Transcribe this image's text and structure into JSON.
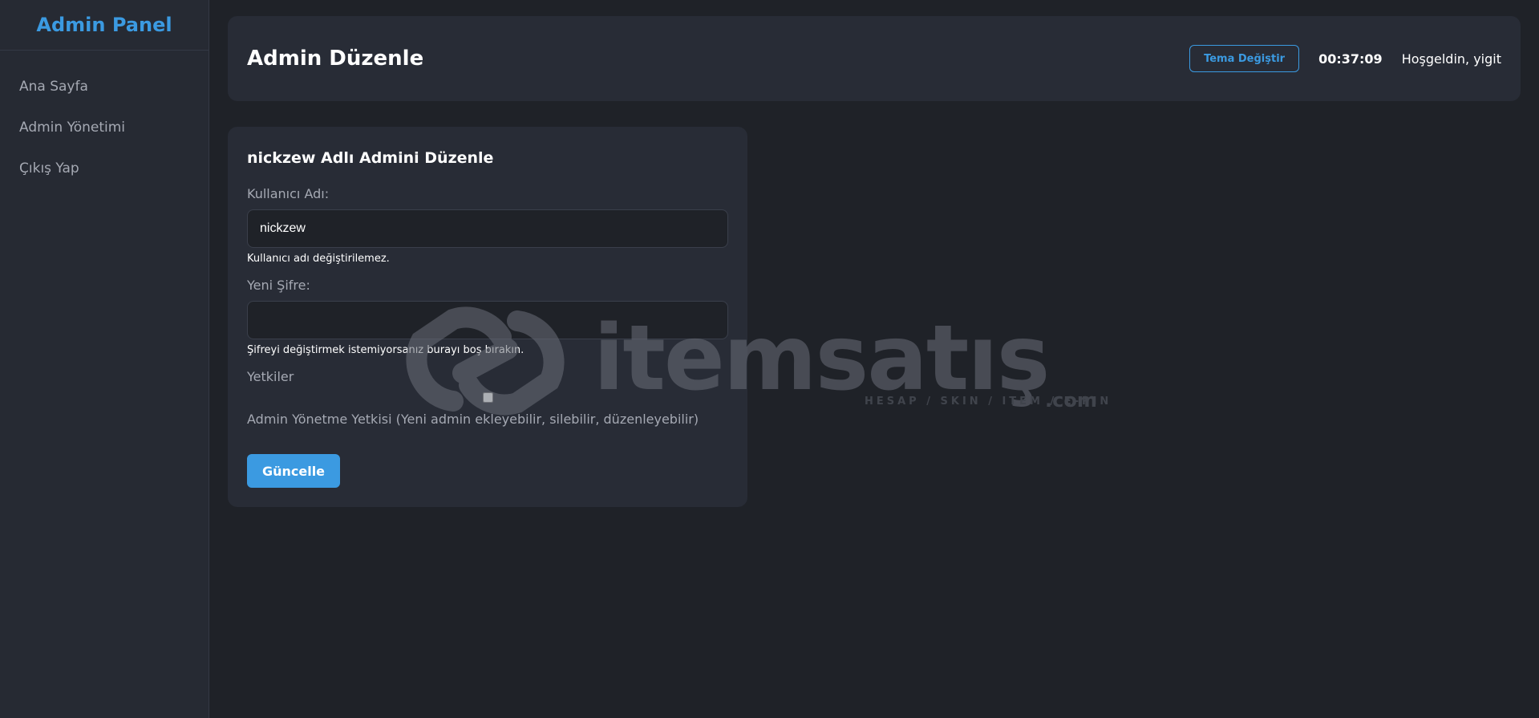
{
  "sidebar": {
    "brand": "Admin Panel",
    "items": [
      {
        "label": "Ana Sayfa"
      },
      {
        "label": "Admin Yönetimi"
      },
      {
        "label": "Çıkış Yap"
      }
    ]
  },
  "header": {
    "title": "Admin Düzenle",
    "theme_button": "Tema Değiştir",
    "clock": "00:37:09",
    "welcome": "Hoşgeldin, yigit"
  },
  "form": {
    "title": "nickzew Adlı Admini Düzenle",
    "username_label": "Kullanıcı Adı:",
    "username_value": "nickzew",
    "username_help": "Kullanıcı adı değiştirilemez.",
    "password_label": "Yeni Şifre:",
    "password_value": "",
    "password_help": "Şifreyi değiştirmek istemiyorsanız burayı boş bırakın.",
    "permissions_label": "Yetkiler",
    "permission_admin_label": "Admin Yönetme Yetkisi (Yeni admin ekleyebilir, silebilir, düzenleyebilir)",
    "permission_admin_checked": false,
    "submit_label": "Güncelle"
  },
  "watermark": {
    "brand": "itemsatış",
    "tagline": "HESAP / SKIN / ITEM / E-PIN",
    "suffix": ".com"
  },
  "colors": {
    "accent": "#3b9ae1",
    "background": "#1f2228",
    "panel": "#282c36"
  }
}
